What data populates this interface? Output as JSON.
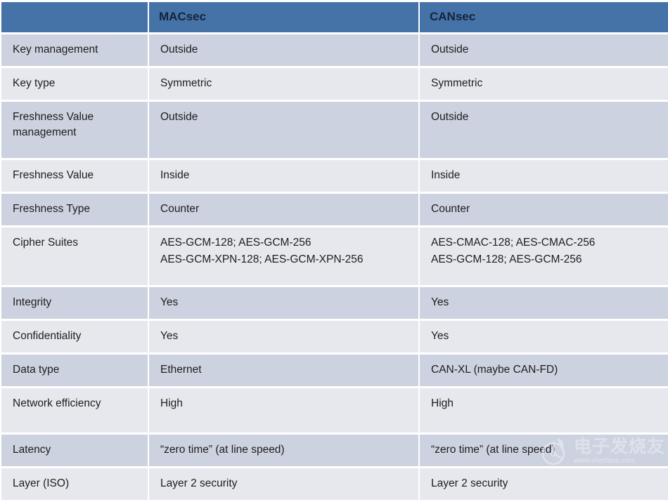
{
  "table": {
    "headers": [
      {
        "label": ""
      },
      {
        "label": "MACsec"
      },
      {
        "label": "CANsec"
      }
    ],
    "rows": [
      {
        "label": "Key management",
        "macsec": [
          "Outside"
        ],
        "cansec": [
          "Outside"
        ]
      },
      {
        "label": "Key type",
        "macsec": [
          "Symmetric"
        ],
        "cansec": [
          "Symmetric"
        ]
      },
      {
        "label": "Freshness Value management",
        "macsec": [
          "Outside"
        ],
        "cansec": [
          "Outside"
        ]
      },
      {
        "label": "Freshness Value",
        "macsec": [
          "Inside"
        ],
        "cansec": [
          "Inside"
        ]
      },
      {
        "label": "Freshness Type",
        "macsec": [
          "Counter"
        ],
        "cansec": [
          "Counter"
        ]
      },
      {
        "label": "Cipher Suites",
        "macsec": [
          "AES-GCM-128; AES-GCM-256",
          "AES-GCM-XPN-128; AES-GCM-XPN-256"
        ],
        "cansec": [
          "AES-CMAC-128; AES-CMAC-256",
          "AES-GCM-128; AES-GCM-256"
        ]
      },
      {
        "label": "Integrity",
        "macsec": [
          "Yes"
        ],
        "cansec": [
          "Yes"
        ]
      },
      {
        "label": "Confidentiality",
        "macsec": [
          "Yes"
        ],
        "cansec": [
          "Yes"
        ]
      },
      {
        "label": "Data type",
        "macsec": [
          "Ethernet"
        ],
        "cansec": [
          "CAN-XL (maybe CAN-FD)"
        ]
      },
      {
        "label": "Network efficiency",
        "macsec": [
          "High"
        ],
        "cansec": [
          "High"
        ]
      },
      {
        "label": "Latency",
        "macsec": [
          "“zero time” (at line speed)"
        ],
        "cansec": [
          "“zero time” (at line speed)"
        ]
      },
      {
        "label": "Layer (ISO)",
        "macsec": [
          "Layer 2 security"
        ],
        "cansec": [
          "Layer 2 security"
        ]
      }
    ]
  },
  "watermark": {
    "brand": "电子发烧友",
    "url": "www.elecfans.com"
  },
  "colors": {
    "header_background": "#4572a7",
    "header_text": "#16233a",
    "row_dark": "#ccd2e0",
    "row_light": "#e7e8ee",
    "body_text": "#1d1d1d",
    "page_background": "#ffffff"
  }
}
